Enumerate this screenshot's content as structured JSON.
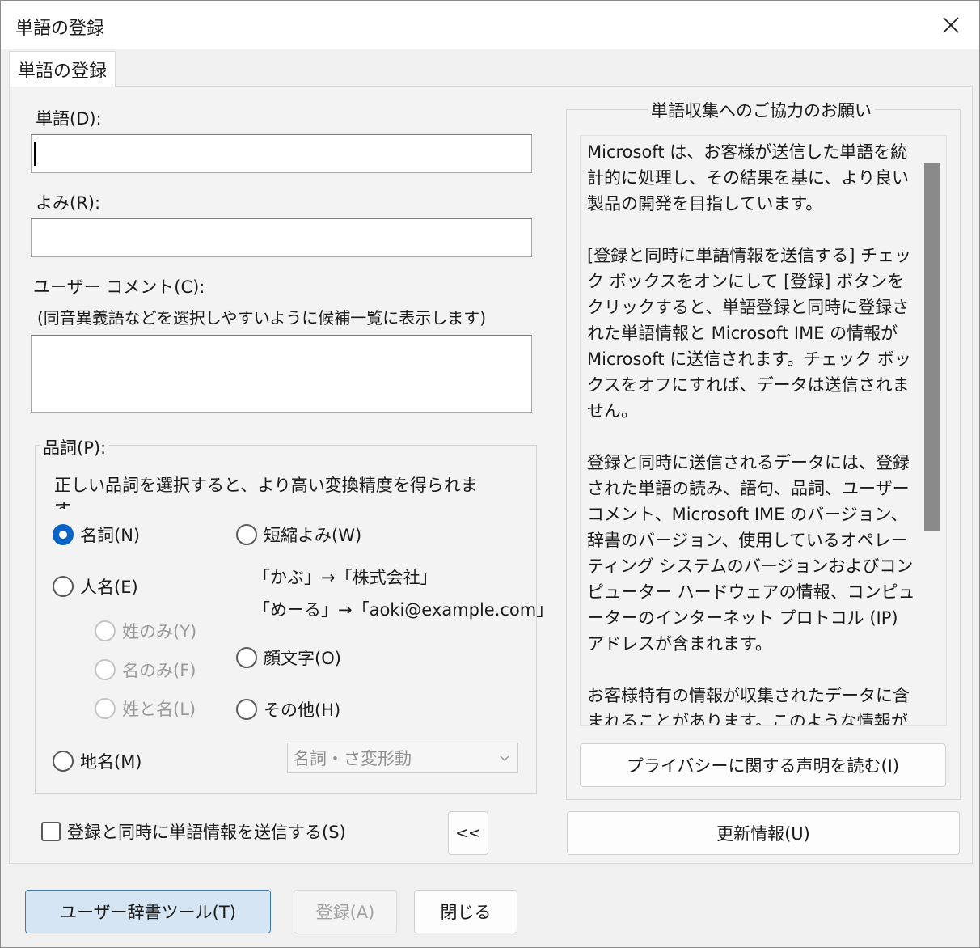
{
  "window": {
    "title": "単語の登録"
  },
  "tab": {
    "label": "単語の登録"
  },
  "form": {
    "word_label": "単語(D):",
    "word_value": "",
    "reading_label": "よみ(R):",
    "reading_value": "",
    "comment_label": "ユーザー コメント(C):",
    "comment_hint": "(同音異義語などを選択しやすいように候補一覧に表示します)",
    "comment_value": ""
  },
  "pos": {
    "legend": "品詞(P):",
    "description": "正しい品詞を選択すると、より高い変換精度を得られます。",
    "noun": "名詞(N)",
    "person_name": "人名(E)",
    "surname_only": "姓のみ(Y)",
    "given_only": "名のみ(F)",
    "surname_and_given": "姓と名(L)",
    "place_name": "地名(M)",
    "abbrev_reading": "短縮よみ(W)",
    "example1": "「かぶ」→「株式会社」",
    "example2": "「めーる」→「aoki@example.com」",
    "emoticon": "顔文字(O)",
    "other": "その他(H)",
    "selected": "noun",
    "other_select_value": "名詞・さ変形動"
  },
  "send_checkbox": {
    "label": "登録と同時に単語情報を送信する(S)",
    "checked": false
  },
  "collapse_button": {
    "label": "<<"
  },
  "info": {
    "legend": "単語収集へのご協力のお願い",
    "paragraphs": [
      "Microsoft は、お客様が送信した単語を統計的に処理し、その結果を基に、より良い製品の開発を目指しています。",
      "[登録と同時に単語情報を送信する] チェック ボックスをオンにして [登録] ボタンをクリックすると、単語登録と同時に登録された単語情報と Microsoft IME の情報が Microsoft に送信されます。チェック ボックスをオフにすれば、データは送信されません。",
      "登録と同時に送信されるデータには、登録された単語の読み、語句、品詞、ユーザー コメント、Microsoft IME のバージョン、辞書のバージョン、使用しているオペレーティング システムのバージョンおよびコンピューター ハードウェアの情報、コンピューターのインターネット プロトコル (IP) アドレスが含まれます。",
      "お客様特有の情報が収集されたデータに含まれることがあります。このような情報が存在する場合でも、Microsoft では、お客様を特定するために使用することはありません。"
    ],
    "privacy_button": "プライバシーに関する声明を読む(I)",
    "update_button": "更新情報(U)"
  },
  "footer": {
    "user_dict_button": "ユーザー辞書ツール(T)",
    "register_button": "登録(A)",
    "close_button": "閉じる"
  }
}
